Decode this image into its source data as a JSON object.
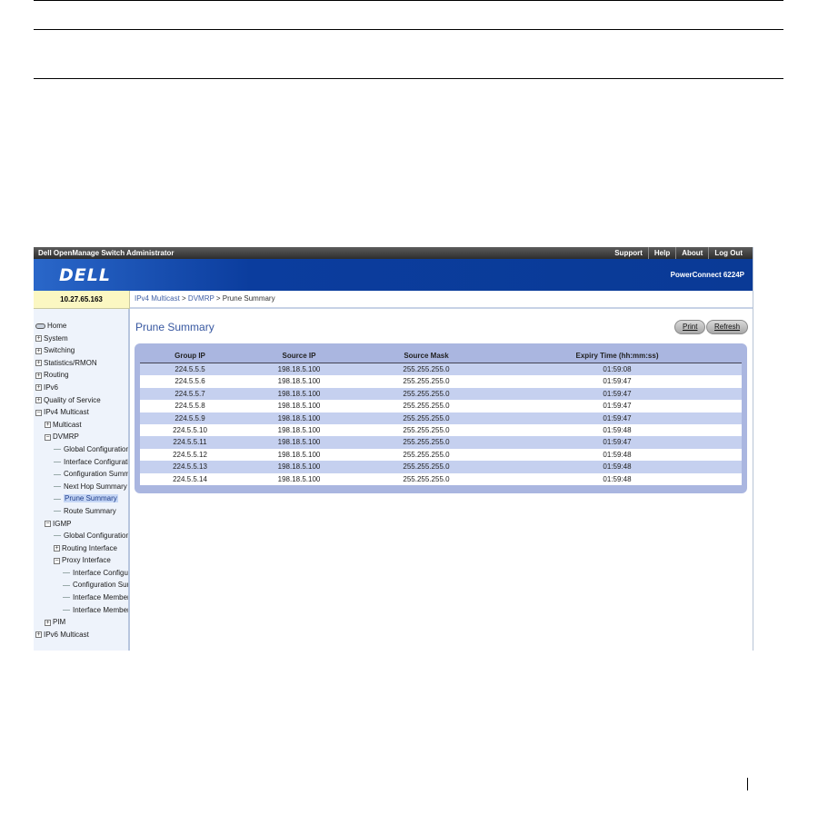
{
  "app": {
    "title": "Dell OpenManage Switch Administrator",
    "links": [
      "Support",
      "Help",
      "About",
      "Log Out"
    ],
    "logo_text": "DELL",
    "model": "PowerConnect 6224P",
    "ip": "10.27.65.163"
  },
  "breadcrumb": {
    "link1": "IPv4 Multicast",
    "sep1": " > ",
    "link2": "DVMRP",
    "sep2": " > ",
    "current": "Prune Summary"
  },
  "sidebar": {
    "items": [
      {
        "label": "Home",
        "indent": 0,
        "icon": "home"
      },
      {
        "label": "System",
        "indent": 0,
        "icon": "plus"
      },
      {
        "label": "Switching",
        "indent": 0,
        "icon": "plus"
      },
      {
        "label": "Statistics/RMON",
        "indent": 0,
        "icon": "plus"
      },
      {
        "label": "Routing",
        "indent": 0,
        "icon": "plus"
      },
      {
        "label": "IPv6",
        "indent": 0,
        "icon": "plus"
      },
      {
        "label": "Quality of Service",
        "indent": 0,
        "icon": "plus"
      },
      {
        "label": "IPv4 Multicast",
        "indent": 0,
        "icon": "minus"
      },
      {
        "label": "Multicast",
        "indent": 1,
        "icon": "plus"
      },
      {
        "label": "DVMRP",
        "indent": 1,
        "icon": "minus"
      },
      {
        "label": "Global Configuration",
        "indent": 2,
        "icon": "line"
      },
      {
        "label": "Interface Configuration",
        "indent": 2,
        "icon": "line"
      },
      {
        "label": "Configuration Summary",
        "indent": 2,
        "icon": "line"
      },
      {
        "label": "Next Hop Summary",
        "indent": 2,
        "icon": "line"
      },
      {
        "label": "Prune Summary",
        "indent": 2,
        "icon": "line",
        "selected": true
      },
      {
        "label": "Route Summary",
        "indent": 2,
        "icon": "line"
      },
      {
        "label": "IGMP",
        "indent": 1,
        "icon": "minus"
      },
      {
        "label": "Global Configuration",
        "indent": 2,
        "icon": "line"
      },
      {
        "label": "Routing Interface",
        "indent": 2,
        "icon": "plus"
      },
      {
        "label": "Proxy Interface",
        "indent": 2,
        "icon": "minus"
      },
      {
        "label": "Interface Configuration",
        "indent": 3,
        "icon": "line"
      },
      {
        "label": "Configuration Summary",
        "indent": 3,
        "icon": "line"
      },
      {
        "label": "Interface Membership Info",
        "indent": 3,
        "icon": "line"
      },
      {
        "label": "Interface Membership Info Detailed",
        "indent": 3,
        "icon": "line"
      },
      {
        "label": "PIM",
        "indent": 1,
        "icon": "plus"
      },
      {
        "label": "IPv6 Multicast",
        "indent": 0,
        "icon": "plus"
      }
    ]
  },
  "main": {
    "title": "Prune Summary",
    "print_label": "Print",
    "refresh_label": "Refresh",
    "columns": [
      "Group IP",
      "Source IP",
      "Source Mask",
      "Expiry Time (hh:mm:ss)"
    ],
    "rows": [
      [
        "224.5.5.5",
        "198.18.5.100",
        "255.255.255.0",
        "01:59:08"
      ],
      [
        "224.5.5.6",
        "198.18.5.100",
        "255.255.255.0",
        "01:59:47"
      ],
      [
        "224.5.5.7",
        "198.18.5.100",
        "255.255.255.0",
        "01:59:47"
      ],
      [
        "224.5.5.8",
        "198.18.5.100",
        "255.255.255.0",
        "01:59:47"
      ],
      [
        "224.5.5.9",
        "198.18.5.100",
        "255.255.255.0",
        "01:59:47"
      ],
      [
        "224.5.5.10",
        "198.18.5.100",
        "255.255.255.0",
        "01:59:48"
      ],
      [
        "224.5.5.11",
        "198.18.5.100",
        "255.255.255.0",
        "01:59:47"
      ],
      [
        "224.5.5.12",
        "198.18.5.100",
        "255.255.255.0",
        "01:59:48"
      ],
      [
        "224.5.5.13",
        "198.18.5.100",
        "255.255.255.0",
        "01:59:48"
      ],
      [
        "224.5.5.14",
        "198.18.5.100",
        "255.255.255.0",
        "01:59:48"
      ]
    ]
  }
}
